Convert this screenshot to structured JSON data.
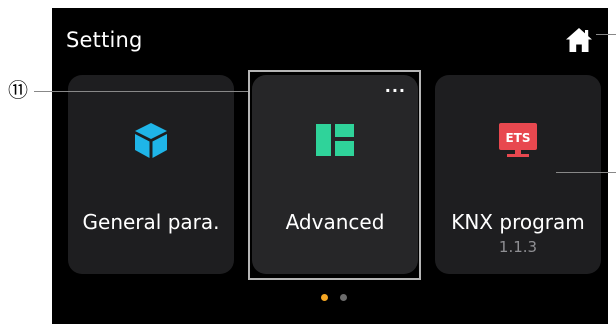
{
  "header": {
    "title": "Setting"
  },
  "icons": {
    "home": "home-icon",
    "general": "cube-icon",
    "advanced": "layout-icon",
    "knx": "ets-monitor-icon",
    "more": "more-dots-icon"
  },
  "cards": [
    {
      "label": "General para.",
      "sublabel": ""
    },
    {
      "label": "Advanced",
      "more": "···"
    },
    {
      "label": "KNX program",
      "sublabel": "1.1.3"
    }
  ],
  "ets_badge": "ETS",
  "callout": {
    "number": "⑪"
  },
  "pager": {
    "pages": 2,
    "current": 1
  },
  "colors": {
    "background": "#000000",
    "card": "#1e1e20",
    "card_selected": "#262628",
    "accent_cyan": "#1fb5e8",
    "accent_green": "#2fd39a",
    "accent_red": "#e8484f",
    "pager_active": "#f5a623",
    "pager_inactive": "#6b6b6b",
    "sublabel": "#8f8f93"
  }
}
